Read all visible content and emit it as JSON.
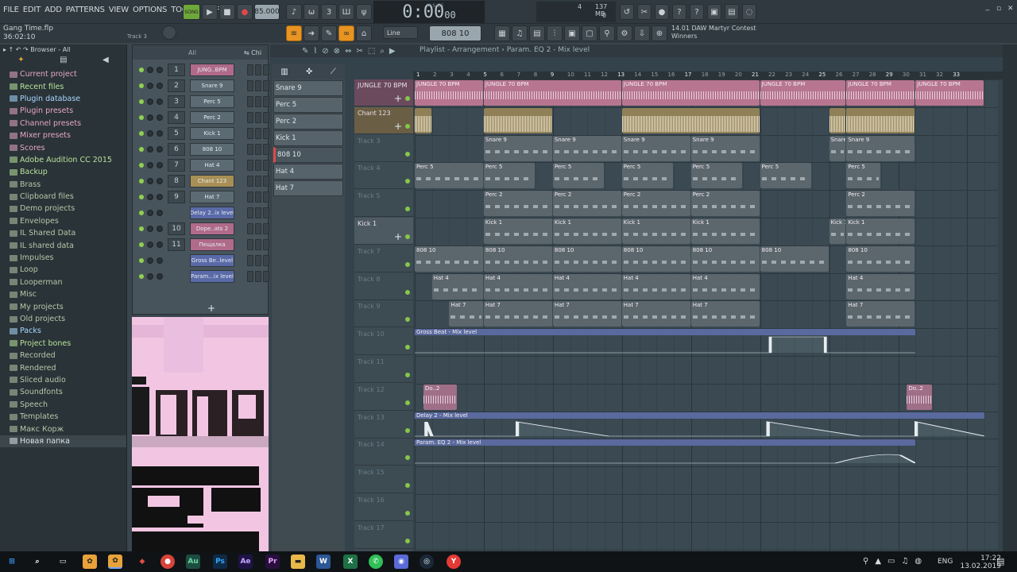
{
  "menu": [
    "FILE",
    "EDIT",
    "ADD",
    "PATTERNS",
    "VIEW",
    "OPTIONS",
    "TOOLS",
    "HELP"
  ],
  "transport": {
    "song_label": "SONG",
    "tempo": "85.000",
    "time": "0:00",
    "time_sub": "00",
    "time_sub_label": "M:S:CS",
    "cpu": "4",
    "memory": "137 MB",
    "voices": "0"
  },
  "project": {
    "file": "Gang Time.flp",
    "time": "36:02:10",
    "track_label": "Track 3"
  },
  "toolbar2": {
    "snap": "Line",
    "pattern": "808 10",
    "hint_line1": "14.01  DAW Martyr Contest",
    "hint_line2": "Winners"
  },
  "browser": {
    "header": "Browser - All",
    "items": [
      {
        "label": "Current project",
        "color": "#e7a6c9"
      },
      {
        "label": "Recent files",
        "color": "#b8e39a"
      },
      {
        "label": "Plugin database",
        "color": "#a8d8ff"
      },
      {
        "label": "Plugin presets",
        "color": "#e7a6c9"
      },
      {
        "label": "Channel presets",
        "color": "#e7a6c9"
      },
      {
        "label": "Mixer presets",
        "color": "#e7a6c9"
      },
      {
        "label": "Scores",
        "color": "#e7a6c9"
      },
      {
        "label": "Adobe Audition CC 2015",
        "color": "#b8e39a"
      },
      {
        "label": "Backup",
        "color": "#b8e39a"
      },
      {
        "label": "Brass",
        "color": "#b5c8a8"
      },
      {
        "label": "Clipboard files",
        "color": "#b5c8a8"
      },
      {
        "label": "Demo projects",
        "color": "#b5c8a8"
      },
      {
        "label": "Envelopes",
        "color": "#b5c8a8"
      },
      {
        "label": "IL Shared Data",
        "color": "#b5c8a8"
      },
      {
        "label": "IL shared data",
        "color": "#b5c8a8"
      },
      {
        "label": "Impulses",
        "color": "#b5c8a8"
      },
      {
        "label": "Loop",
        "color": "#b5c8a8"
      },
      {
        "label": "Looperman",
        "color": "#b5c8a8"
      },
      {
        "label": "Misc",
        "color": "#b5c8a8"
      },
      {
        "label": "My projects",
        "color": "#b5c8a8"
      },
      {
        "label": "Old projects",
        "color": "#b5c8a8"
      },
      {
        "label": "Packs",
        "color": "#a8d8ff"
      },
      {
        "label": "Project bones",
        "color": "#b8e39a"
      },
      {
        "label": "Recorded",
        "color": "#b5c8a8"
      },
      {
        "label": "Rendered",
        "color": "#b5c8a8"
      },
      {
        "label": "Sliced audio",
        "color": "#b5c8a8"
      },
      {
        "label": "Soundfonts",
        "color": "#b5c8a8"
      },
      {
        "label": "Speech",
        "color": "#b5c8a8"
      },
      {
        "label": "Templates",
        "color": "#b5c8a8"
      },
      {
        "label": "Макс Корж",
        "color": "#b5c8a8"
      },
      {
        "label": "Новая папка",
        "color": "#dfe6ea"
      }
    ]
  },
  "channel_rack": {
    "filter": "All",
    "channels": [
      {
        "num": "1",
        "name": "JUNG..BPM",
        "style": "pink"
      },
      {
        "num": "2",
        "name": "Snare 9",
        "style": ""
      },
      {
        "num": "3",
        "name": "Perc 5",
        "style": ""
      },
      {
        "num": "4",
        "name": "Perc 2",
        "style": ""
      },
      {
        "num": "5",
        "name": "Kick 1",
        "style": ""
      },
      {
        "num": "6",
        "name": "808 10",
        "style": ""
      },
      {
        "num": "7",
        "name": "Hat 4",
        "style": ""
      },
      {
        "num": "8",
        "name": "Chant 123",
        "style": "gold"
      },
      {
        "num": "9",
        "name": "Hat 7",
        "style": ""
      },
      {
        "num": "",
        "name": "Delay 2..ix level",
        "style": "blue"
      },
      {
        "num": "10",
        "name": "Dope..ats 2",
        "style": "pink"
      },
      {
        "num": "11",
        "name": "Пещалка",
        "style": "pink"
      },
      {
        "num": "",
        "name": "Gross Be..level",
        "style": "blue"
      },
      {
        "num": "",
        "name": "Param...ix level",
        "style": "blue"
      }
    ]
  },
  "picker": [
    "Snare 9",
    "Perc 5",
    "Perc 2",
    "Kick 1",
    "808 10",
    "Hat 4",
    "Hat 7"
  ],
  "playlist": {
    "title": "Playlist - Arrangement",
    "breadcrumb": "Param. EQ 2 - Mix level",
    "bars": [
      "1",
      "2",
      "3",
      "4",
      "5",
      "6",
      "7",
      "8",
      "9",
      "10",
      "11",
      "12",
      "13",
      "14",
      "15",
      "16",
      "17",
      "18",
      "19",
      "20",
      "21",
      "22",
      "23",
      "24",
      "25",
      "26",
      "27",
      "28",
      "29",
      "30",
      "31",
      "32",
      "33"
    ],
    "tracks": [
      {
        "name": "JUNGLE 70 BPM",
        "active": true
      },
      {
        "name": "Chant 123",
        "active": true
      },
      {
        "name": "Track 3",
        "active": false
      },
      {
        "name": "Track 4",
        "active": false
      },
      {
        "name": "Track 5",
        "active": false
      },
      {
        "name": "Kick 1",
        "active": true
      },
      {
        "name": "Track 7",
        "active": false
      },
      {
        "name": "Track 8",
        "active": false
      },
      {
        "name": "Track 9",
        "active": false
      },
      {
        "name": "Track 10",
        "active": false
      },
      {
        "name": "Track 11",
        "active": false
      },
      {
        "name": "Track 12",
        "active": false
      },
      {
        "name": "Track 13",
        "active": false
      },
      {
        "name": "Track 14",
        "active": false
      },
      {
        "name": "Track 15",
        "active": false
      },
      {
        "name": "Track 16",
        "active": false
      },
      {
        "name": "Track 17",
        "active": false
      }
    ],
    "clip_labels": {
      "jungle": "JUNGLE 70 BPM",
      "snare": "Snare 9",
      "perc5": "Perc 5",
      "perc2": "Perc 2",
      "kick": "Kick 1",
      "bass": "808 10",
      "hat4": "Hat 4",
      "hat7": "Hat 7",
      "gross": "Gross Beat - Mix level",
      "dope": "Do..2",
      "delay": "Delay 2 - Mix level",
      "eq": "Param. EQ 2 - Mix level"
    }
  },
  "taskbar": {
    "lang": "ENG",
    "time": "17:22",
    "date": "13.02.2019",
    "apps": [
      "Au",
      "Ps",
      "Ae",
      "Pr",
      "W",
      "X"
    ]
  },
  "colors": {
    "accent": "#e89422",
    "clip_pink": "#c9859f",
    "clip_gray": "#5b666d",
    "clip_gold": "#b9a46a",
    "automation": "#6a7fb5"
  }
}
